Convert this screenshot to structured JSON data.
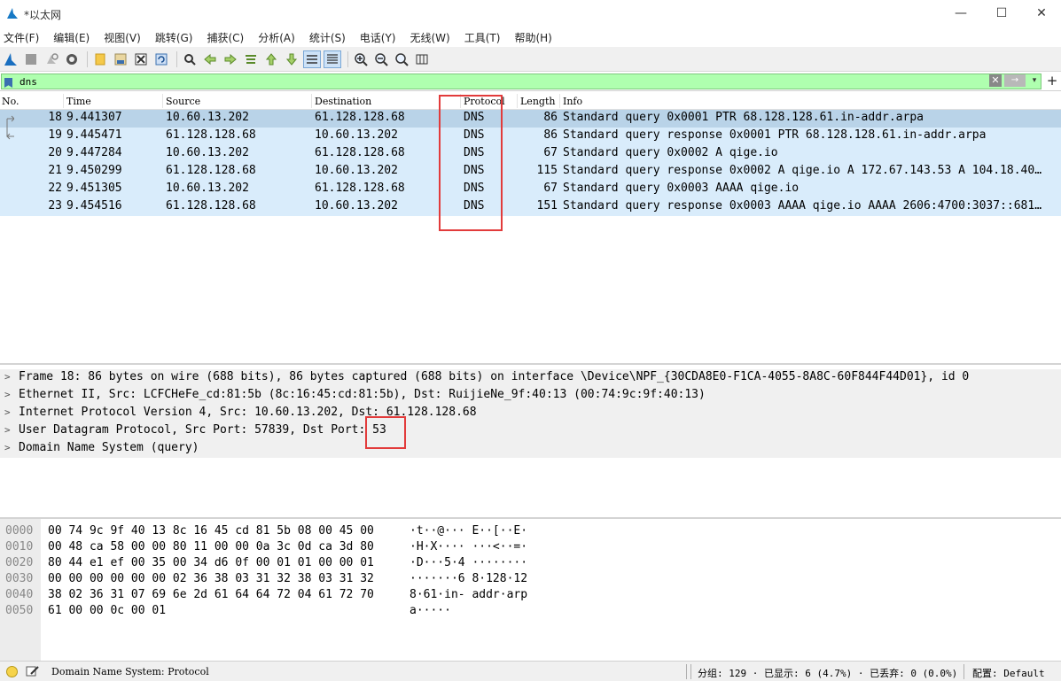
{
  "window": {
    "title": "*以太网",
    "minimize": "—",
    "maximize": "☐",
    "close": "✕"
  },
  "menu": [
    "文件(F)",
    "编辑(E)",
    "视图(V)",
    "跳转(G)",
    "捕获(C)",
    "分析(A)",
    "统计(S)",
    "电话(Y)",
    "无线(W)",
    "工具(T)",
    "帮助(H)"
  ],
  "toolbar": {
    "icons": [
      "shark-fin-start-icon",
      "stop-icon",
      "restart-icon",
      "capture-options-icon",
      "open-file-icon",
      "save-file-icon",
      "close-file-icon",
      "reload-icon",
      "find-packet-icon",
      "go-back-icon",
      "go-forward-icon",
      "go-to-packet-icon",
      "first-packet-icon",
      "last-packet-icon",
      "autoscroll-icon",
      "colorize-icon",
      "zoom-in-icon",
      "zoom-out-icon",
      "normal-size-icon",
      "resize-columns-icon"
    ]
  },
  "filter": {
    "value": "dns",
    "clear": "✕",
    "apply": "→",
    "dropdown": "▾",
    "add": "+"
  },
  "packet_list": {
    "columns": [
      "No.",
      "Time",
      "Source",
      "Destination",
      "Protocol",
      "Length",
      "Info"
    ],
    "rows": [
      {
        "no": "18",
        "time": "9.441307",
        "src": "10.60.13.202",
        "dst": "61.128.128.68",
        "proto": "DNS",
        "len": "86",
        "info": "Standard query 0x0001 PTR 68.128.128.61.in-addr.arpa"
      },
      {
        "no": "19",
        "time": "9.445471",
        "src": "61.128.128.68",
        "dst": "10.60.13.202",
        "proto": "DNS",
        "len": "86",
        "info": "Standard query response 0x0001 PTR 68.128.128.61.in-addr.arpa"
      },
      {
        "no": "20",
        "time": "9.447284",
        "src": "10.60.13.202",
        "dst": "61.128.128.68",
        "proto": "DNS",
        "len": "67",
        "info": "Standard query 0x0002 A qige.io"
      },
      {
        "no": "21",
        "time": "9.450299",
        "src": "61.128.128.68",
        "dst": "10.60.13.202",
        "proto": "DNS",
        "len": "115",
        "info": "Standard query response 0x0002 A qige.io A 172.67.143.53 A 104.18.40…"
      },
      {
        "no": "22",
        "time": "9.451305",
        "src": "10.60.13.202",
        "dst": "61.128.128.68",
        "proto": "DNS",
        "len": "67",
        "info": "Standard query 0x0003 AAAA qige.io"
      },
      {
        "no": "23",
        "time": "9.454516",
        "src": "61.128.128.68",
        "dst": "10.60.13.202",
        "proto": "DNS",
        "len": "151",
        "info": "Standard query response 0x0003 AAAA qige.io AAAA 2606:4700:3037::681…"
      }
    ]
  },
  "details": [
    "Frame 18: 86 bytes on wire (688 bits), 86 bytes captured (688 bits) on interface \\Device\\NPF_{30CDA8E0-F1CA-4055-8A8C-60F844F44D01}, id 0",
    "Ethernet II, Src: LCFCHeFe_cd:81:5b (8c:16:45:cd:81:5b), Dst: RuijieNe_9f:40:13 (00:74:9c:9f:40:13)",
    "Internet Protocol Version 4, Src: 10.60.13.202, Dst: 61.128.128.68",
    "User Datagram Protocol, Src Port: 57839, Dst Port: 53",
    "Domain Name System (query)"
  ],
  "bytes": [
    {
      "offset": "0000",
      "hex": "00 74 9c 9f 40 13 8c 16  45 cd 81 5b 08 00 45 00",
      "ascii": "·t··@··· E··[··E·"
    },
    {
      "offset": "0010",
      "hex": "00 48 ca 58 00 00 80 11  00 00 0a 3c 0d ca 3d 80",
      "ascii": "·H·X···· ···<··=·"
    },
    {
      "offset": "0020",
      "hex": "80 44 e1 ef 00 35 00 34  d6 0f 00 01 01 00 00 01",
      "ascii": "·D···5·4 ········"
    },
    {
      "offset": "0030",
      "hex": "00 00 00 00 00 00 02 36  38 03 31 32 38 03 31 32",
      "ascii": "·······6 8·128·12"
    },
    {
      "offset": "0040",
      "hex": "38 02 36 31 07 69 6e 2d  61 64 64 72 04 61 72 70",
      "ascii": "8·61·in- addr·arp"
    },
    {
      "offset": "0050",
      "hex": "61 00 00 0c 00 01",
      "ascii": "a·····"
    }
  ],
  "status": {
    "field": "Domain Name System: Protocol",
    "stats": "分组: 129 · 已显示: 6 (4.7%) · 已丢弃: 0 (0.0%)",
    "profile": "配置: Default"
  }
}
